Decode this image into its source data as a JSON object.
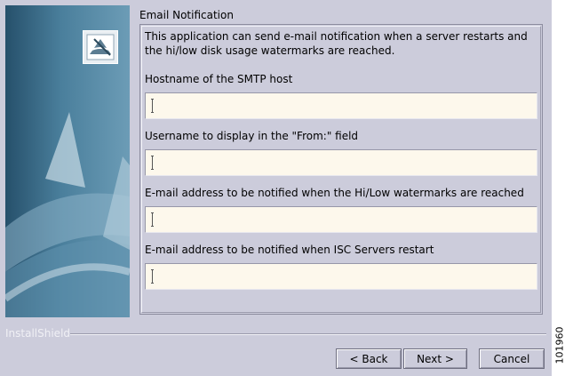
{
  "section": {
    "title": "Email Notification"
  },
  "description": "This application can send e-mail notification when a server restarts and the hi/low disk usage watermarks are reached.",
  "fields": [
    {
      "label": "Hostname of the SMTP host",
      "value": ""
    },
    {
      "label": "Username to display in the \"From:\" field",
      "value": ""
    },
    {
      "label": "E-mail address to be notified when the Hi/Low watermarks are reached",
      "value": ""
    },
    {
      "label": "E-mail address to be notified when ISC Servers restart",
      "value": ""
    }
  ],
  "brand": "InstallShield",
  "buttons": {
    "back": "< Back",
    "next": "Next >",
    "cancel": "Cancel"
  },
  "figure_id": "101960",
  "banner": {
    "logo_icon": "installer-logo-icon",
    "decor": "sail-shapes"
  },
  "colors": {
    "dialog_bg": "#ccccdb",
    "field_bg": "#fdf8ec",
    "banner": "#3c6e8c"
  }
}
